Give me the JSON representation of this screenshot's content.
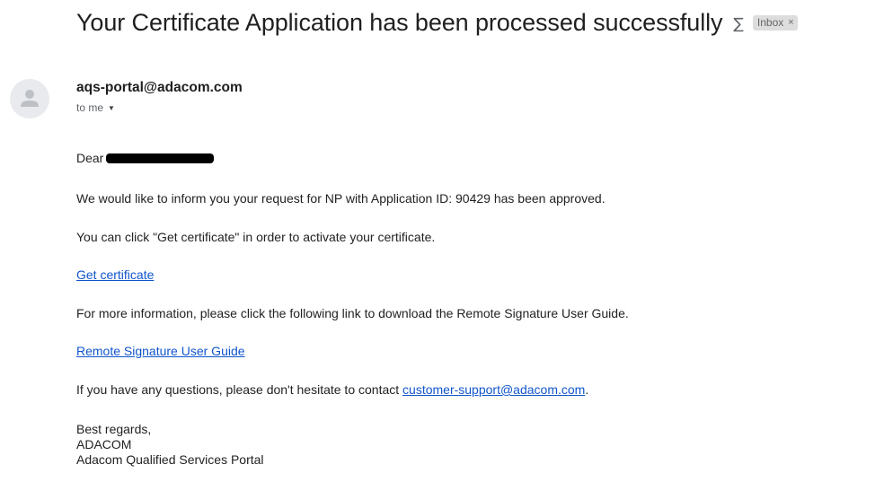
{
  "email": {
    "subject": "Your Certificate Application has been processed successfully",
    "label": "Inbox",
    "label_close": "×",
    "sender": "aqs-portal@adacom.com",
    "recipient_line": "to me",
    "body": {
      "greeting": "Dear",
      "line1": "We would like to inform you your request for NP with Application ID: 90429 has been approved.",
      "line2": "You can click \"Get certificate\" in order to activate your certificate.",
      "link_get_certificate": "Get certificate",
      "line3": "For more information, please click the following link to download the Remote Signature User Guide.",
      "link_user_guide": "Remote Signature User Guide",
      "line4_prefix": "If you have any questions, please don't hesitate to contact ",
      "support_email": "customer-support@adacom.com",
      "line4_suffix": ".",
      "closing": "Best regards,",
      "signature_company": "ADACOM",
      "signature_portal": "Adacom Qualified Services Portal"
    }
  },
  "icons": {
    "summary": "summarize-icon",
    "avatar": "default-avatar-icon",
    "caret": "caret-down-icon"
  },
  "colors": {
    "link": "#1155cc",
    "chip_bg": "#dddddd"
  }
}
